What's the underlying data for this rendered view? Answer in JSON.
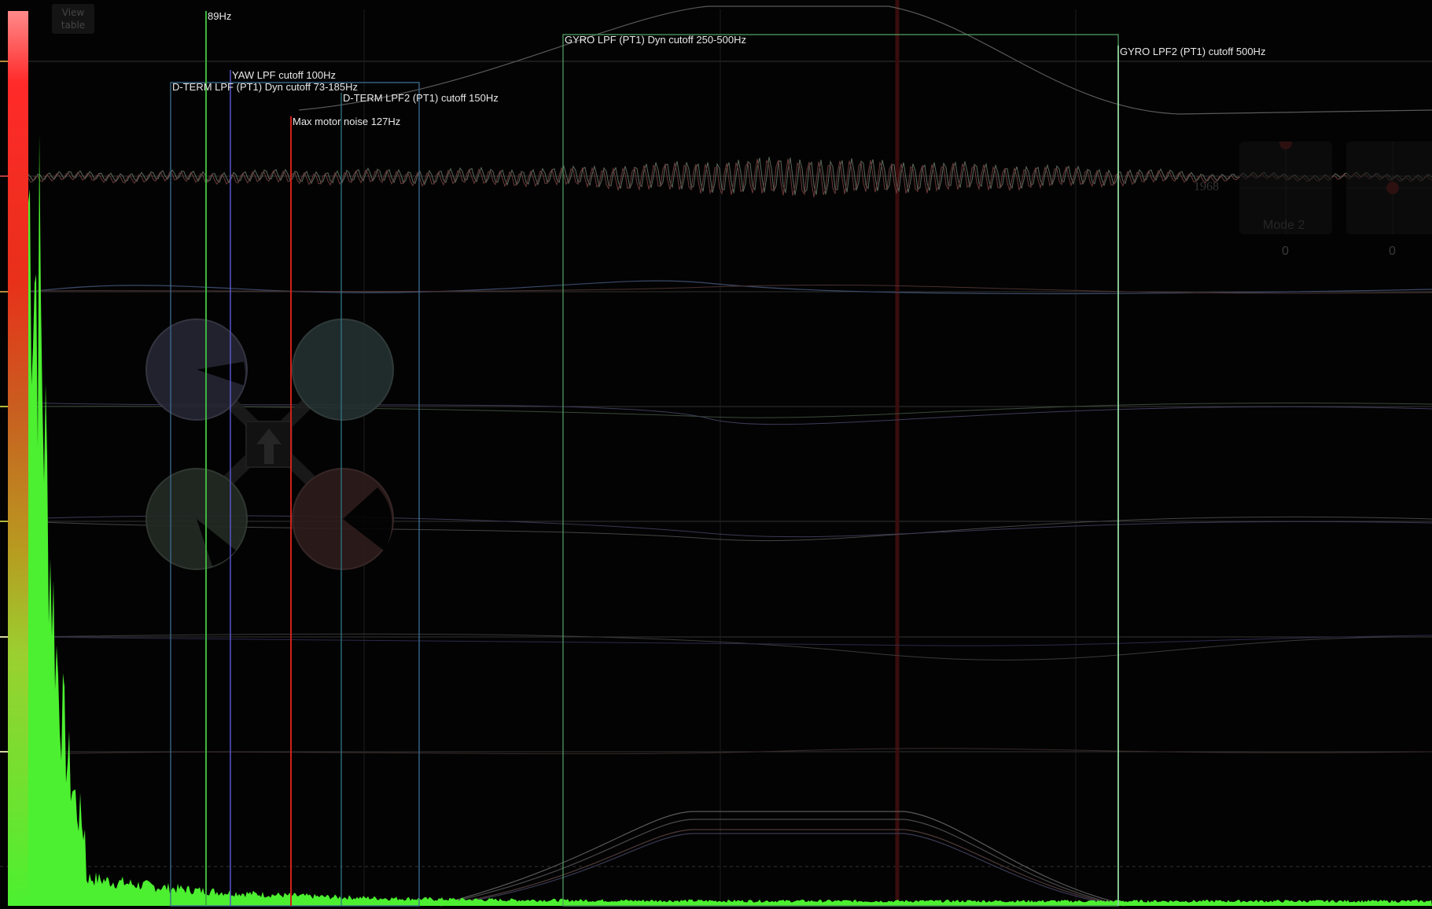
{
  "toolbar": {
    "view_table_line1": "View",
    "view_table_line2": "table"
  },
  "markers": {
    "freq_89": "89Hz",
    "yaw_lpf": "YAW LPF cutoff 100Hz",
    "dterm_lpf": "D-TERM LPF (PT1) Dyn cutoff 73-185Hz",
    "dterm_lpf2": "D-TERM LPF2 (PT1) cutoff 150Hz",
    "max_motor_noise": "Max motor noise 127Hz",
    "gyro_lpf": "GYRO LPF (PT1) Dyn cutoff 250-500Hz",
    "gyro_lpf2": "GYRO LPF2 (PT1) cutoff 500Hz"
  },
  "sticks": {
    "mode": "Mode 2",
    "left_value": "0",
    "right_value": "0"
  },
  "overlay": {
    "motor_value": "1968"
  },
  "colors": {
    "freq_89": "#3db53d",
    "yaw_lpf": "#5656c8",
    "dterm_lpf": "#4a7aa8",
    "dterm_lpf2": "#3a8ca0",
    "max_motor_noise": "#d0201a",
    "gyro_lpf": "#6fb87f",
    "gyro_lpf2": "#8fd69f"
  }
}
